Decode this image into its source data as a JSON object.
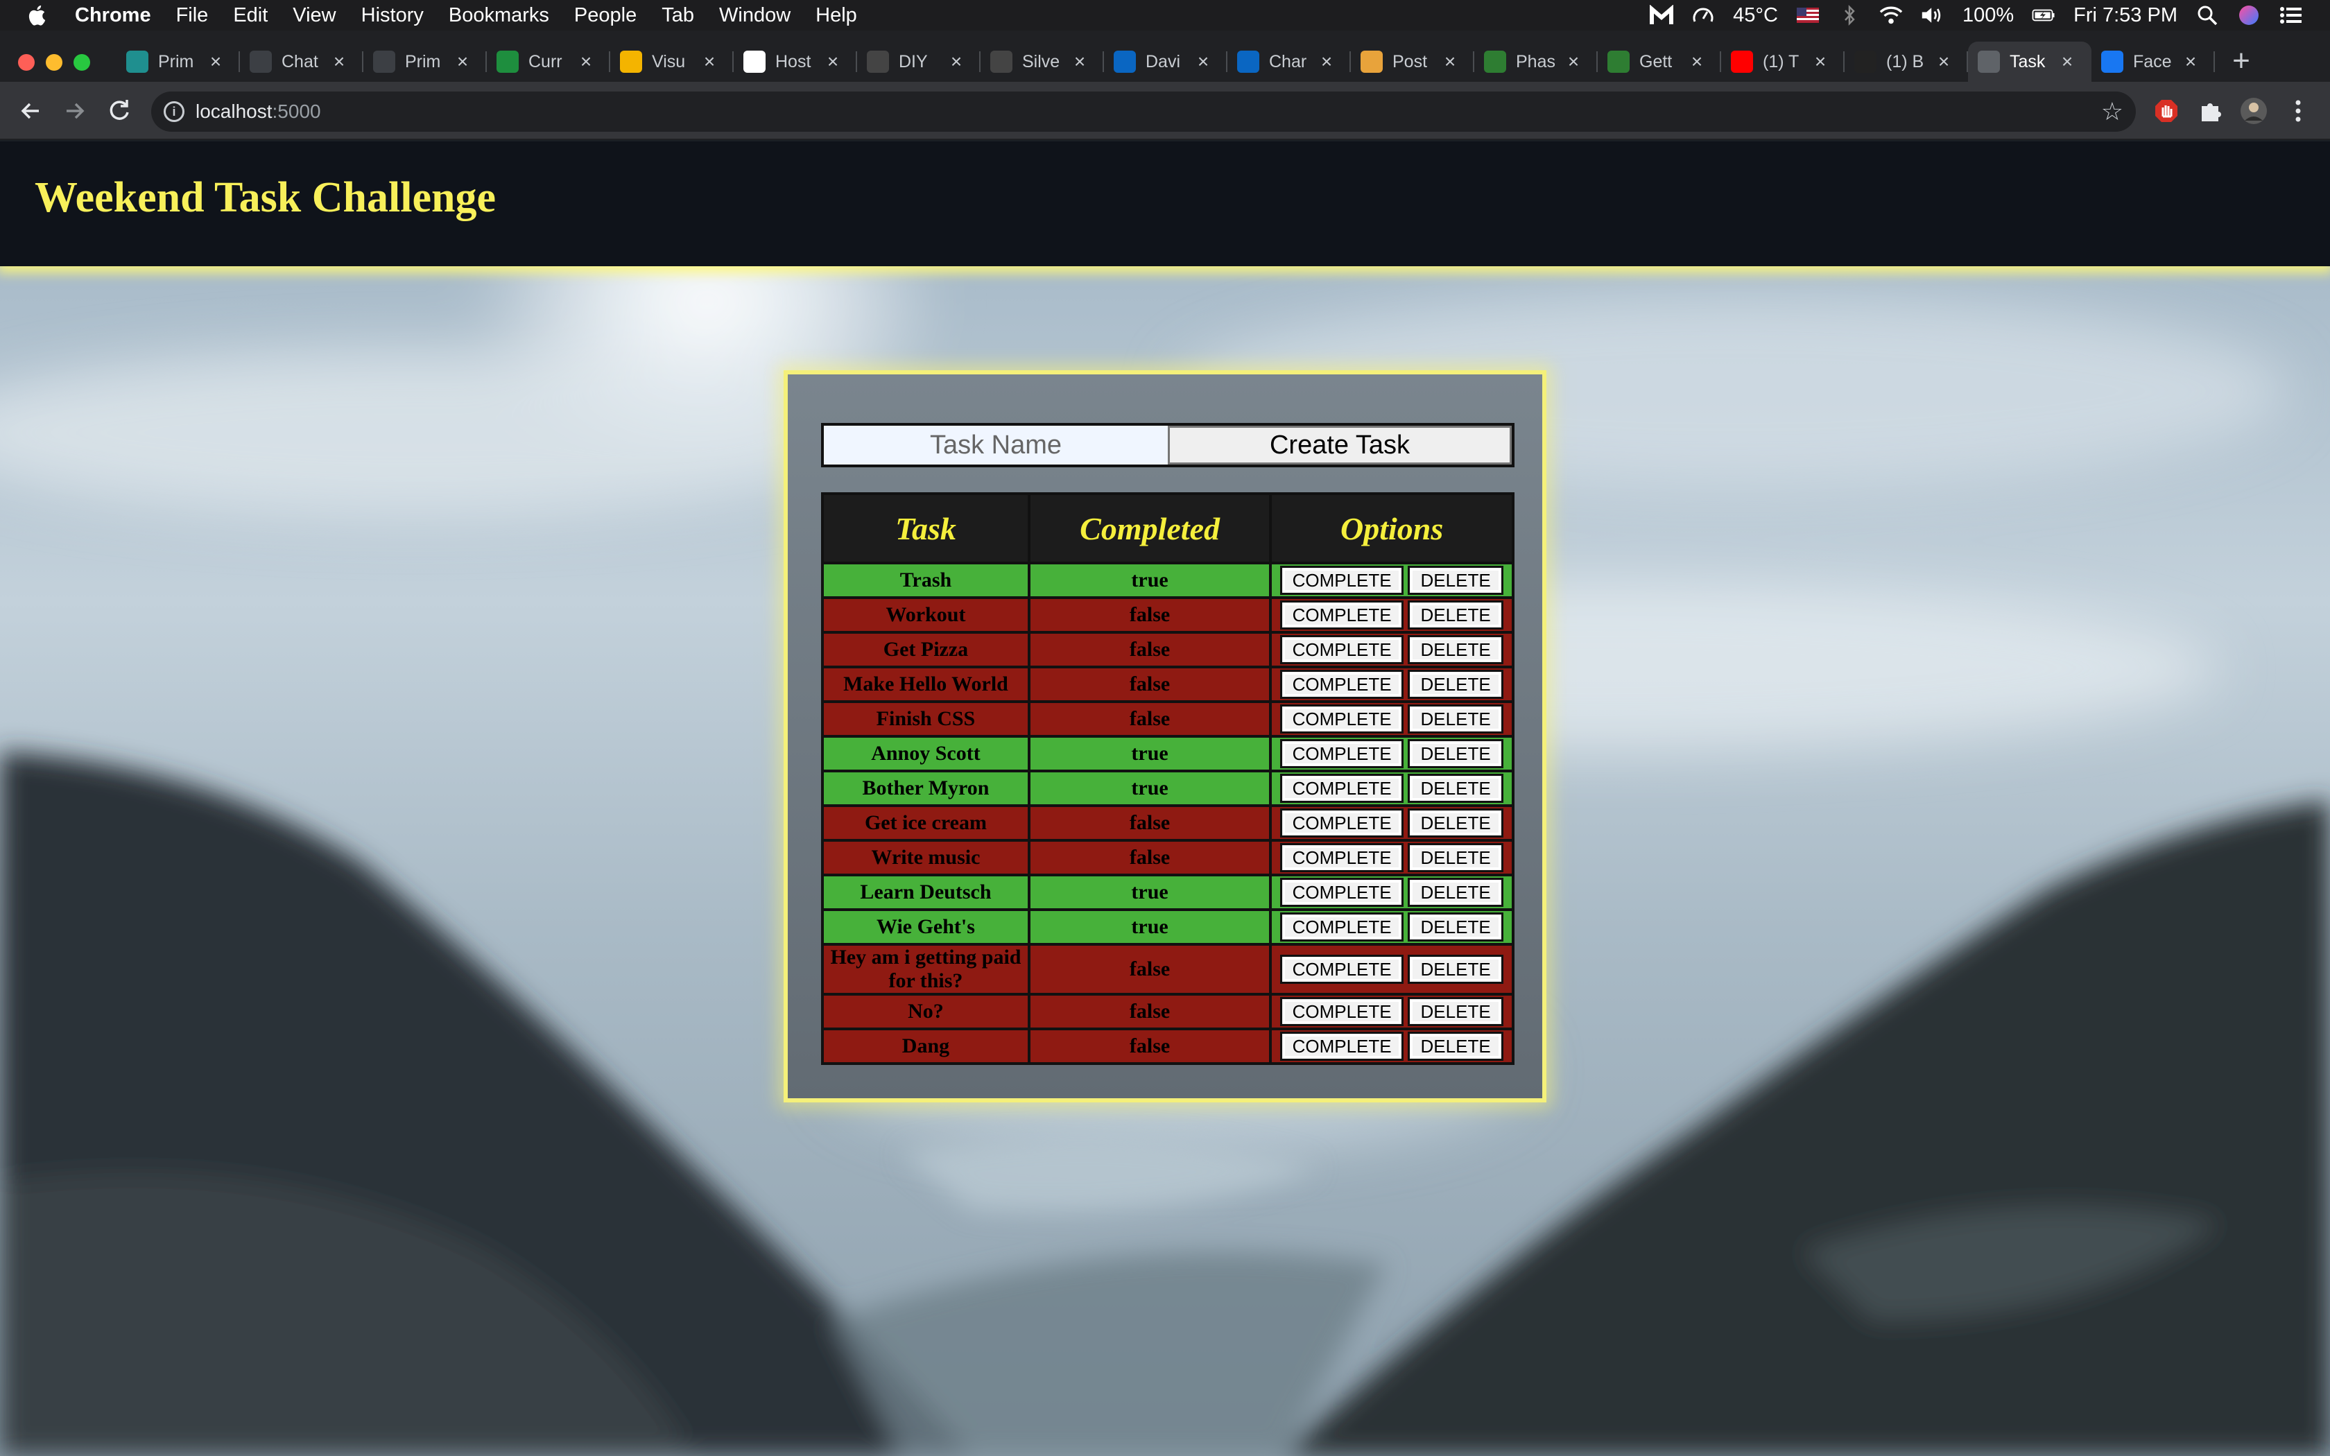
{
  "menubar": {
    "app": "Chrome",
    "items": [
      "File",
      "Edit",
      "View",
      "History",
      "Bookmarks",
      "People",
      "Tab",
      "Window",
      "Help"
    ],
    "temperature": "45°C",
    "battery": "100%",
    "clock": "Fri 7:53 PM"
  },
  "browser": {
    "tabs": [
      {
        "label": "Prim",
        "icon": "slides-icon",
        "color": "#1f8f8f"
      },
      {
        "label": "Chat",
        "icon": "github-icon",
        "color": "#3c3f44"
      },
      {
        "label": "Prim",
        "icon": "github-icon",
        "color": "#3c3f44"
      },
      {
        "label": "Curr",
        "icon": "sheets-icon",
        "color": "#1e8e3e"
      },
      {
        "label": "Visu",
        "icon": "slides-icon",
        "color": "#f4b400"
      },
      {
        "label": "Host",
        "icon": "photos-icon",
        "color": "#ffffff"
      },
      {
        "label": "DIY",
        "icon": "site-icon",
        "color": "#444444"
      },
      {
        "label": "Silve",
        "icon": "site-icon",
        "color": "#444444"
      },
      {
        "label": "Davi",
        "icon": "linkedin-icon",
        "color": "#0a66c2"
      },
      {
        "label": "Char",
        "icon": "linkedin-icon",
        "color": "#0a66c2"
      },
      {
        "label": "Post",
        "icon": "site-icon",
        "color": "#e8a33b"
      },
      {
        "label": "Phas",
        "icon": "site-icon",
        "color": "#2e7d32"
      },
      {
        "label": "Gett",
        "icon": "site-icon",
        "color": "#2e7d32"
      },
      {
        "label": "(1) T",
        "icon": "youtube-icon",
        "color": "#ff0000"
      },
      {
        "label": "(1) B",
        "icon": "site-icon",
        "color": "#222222"
      },
      {
        "label": "Task",
        "icon": "globe-icon",
        "color": "#5f6368",
        "active": true
      },
      {
        "label": "Face",
        "icon": "facebook-icon",
        "color": "#1877f2"
      }
    ],
    "url_host": "localhost",
    "url_port": ":5000"
  },
  "page": {
    "title": "Weekend Task Challenge",
    "input_placeholder": "Task Name",
    "create_label": "Create Task",
    "headers": {
      "task": "Task",
      "completed": "Completed",
      "options": "Options"
    },
    "complete_label": "COMPLETE",
    "delete_label": "DELETE",
    "tasks": [
      {
        "name": "Trash",
        "completed": "true"
      },
      {
        "name": "Workout",
        "completed": "false"
      },
      {
        "name": "Get Pizza",
        "completed": "false"
      },
      {
        "name": "Make Hello World",
        "completed": "false"
      },
      {
        "name": "Finish CSS",
        "completed": "false"
      },
      {
        "name": "Annoy Scott",
        "completed": "true"
      },
      {
        "name": "Bother Myron",
        "completed": "true"
      },
      {
        "name": "Get ice cream",
        "completed": "false"
      },
      {
        "name": "Write music",
        "completed": "false"
      },
      {
        "name": "Learn Deutsch",
        "completed": "true"
      },
      {
        "name": "Wie Geht's",
        "completed": "true"
      },
      {
        "name": "Hey am i getting paid for this?",
        "completed": "false"
      },
      {
        "name": "No?",
        "completed": "false"
      },
      {
        "name": "Dang",
        "completed": "false"
      }
    ]
  },
  "colors": {
    "header_bg": "#0f131a",
    "title_yellow": "#f8f05a",
    "done_green": "#47b13a",
    "todo_red": "#8f1a12",
    "panel_border": "#f4f07a"
  }
}
